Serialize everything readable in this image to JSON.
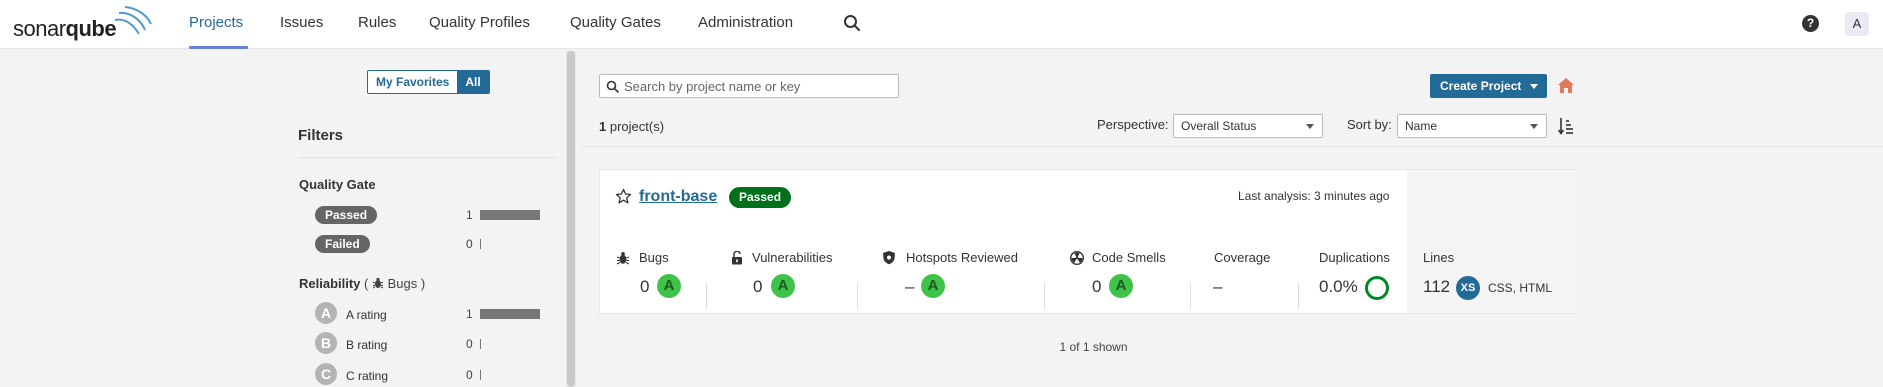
{
  "nav": {
    "logo_text_regular": "sonar",
    "logo_text_bold": "qube",
    "items": [
      {
        "label": "Projects",
        "active": true
      },
      {
        "label": "Issues"
      },
      {
        "label": "Rules"
      },
      {
        "label": "Quality Profiles"
      },
      {
        "label": "Quality Gates"
      },
      {
        "label": "Administration"
      }
    ],
    "search_icon": "search-icon",
    "help_icon": "question-circle-icon",
    "help_glyph": "?",
    "avatar_letter": "A"
  },
  "sidebar": {
    "favorites_toggle": {
      "my_favorites": "My Favorites",
      "all": "All",
      "selected": "All"
    },
    "filters_title": "Filters",
    "quality_gate": {
      "title": "Quality Gate",
      "options": [
        {
          "label": "Passed",
          "count": "1",
          "fraction": 1
        },
        {
          "label": "Failed",
          "count": "0",
          "fraction": 0
        }
      ]
    },
    "reliability": {
      "title": "Reliability",
      "paren_open": "(",
      "subtitle": "Bugs",
      "paren_close": ")",
      "icon": "bug-icon",
      "options": [
        {
          "grade": "A",
          "label": "A rating",
          "count": "1",
          "fraction": 1
        },
        {
          "grade": "B",
          "label": "B rating",
          "count": "0",
          "fraction": 0
        },
        {
          "grade": "C",
          "label": "C rating",
          "count": "0",
          "fraction": 0
        }
      ]
    }
  },
  "main": {
    "search_placeholder": "Search by project name or key",
    "create_project_label": "Create Project",
    "home_icon": "home-icon",
    "count_number": "1",
    "count_suffix": " project(s)",
    "perspective_label": "Perspective:",
    "perspective_value": "Overall Status",
    "sort_label": "Sort by:",
    "sort_value": "Name",
    "sort_icon": "sort-ascending-icon",
    "project": {
      "name": "front-base",
      "quality_gate": "Passed",
      "last_analysis": "Last analysis: 3 minutes ago",
      "favorite_icon": "star-outline-icon",
      "measures": {
        "bugs": {
          "label": "Bugs",
          "value": "0",
          "rating": "A",
          "icon": "bug-icon"
        },
        "vulnerabilities": {
          "label": "Vulnerabilities",
          "value": "0",
          "rating": "A",
          "icon": "lock-open-icon"
        },
        "hotspots": {
          "label": "Hotspots Reviewed",
          "value": "–",
          "rating": "A",
          "icon": "shield-icon"
        },
        "code_smells": {
          "label": "Code Smells",
          "value": "0",
          "rating": "A",
          "icon": "radiation-icon"
        },
        "coverage": {
          "label": "Coverage",
          "value": "–"
        },
        "duplications": {
          "label": "Duplications",
          "value": "0.0%",
          "icon": "duplication-ring-icon"
        },
        "lines": {
          "label": "Lines",
          "value": "112",
          "size": "XS",
          "languages": "CSS, HTML"
        }
      }
    },
    "shown_text": "1 of 1 shown"
  },
  "colors": {
    "brand_blue": "#236a97",
    "nav_active_underline": "#6b7fd7",
    "passed_green": "#00701a",
    "rating_a_green": "#3fc248",
    "duplication_ring": "#008a25",
    "home_orange": "#e07a5f"
  }
}
